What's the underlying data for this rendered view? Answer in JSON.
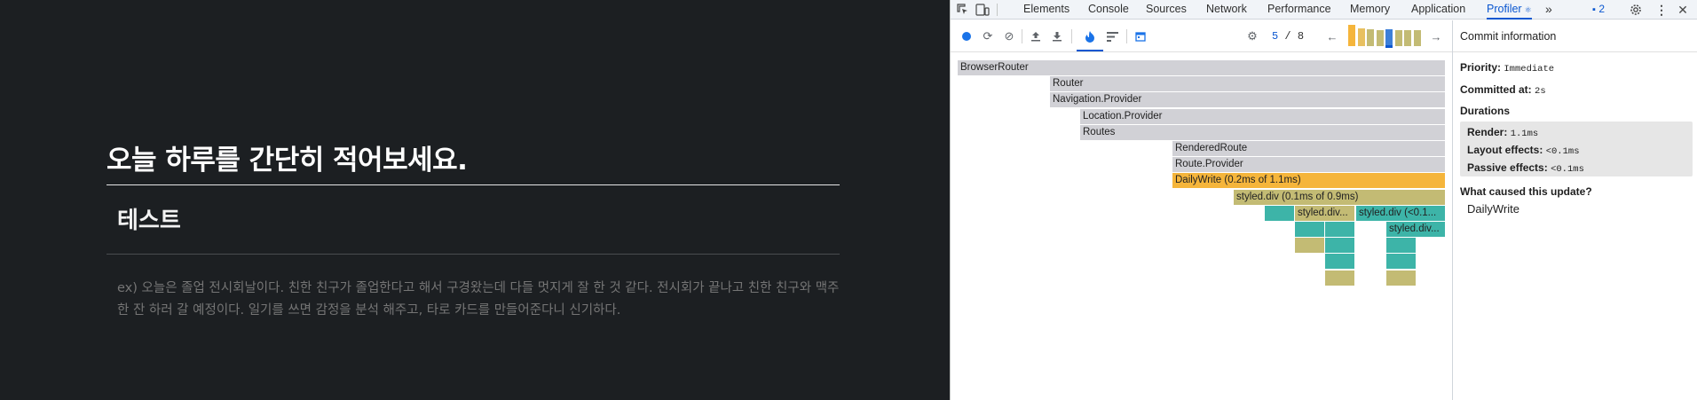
{
  "app": {
    "heading": "오늘 하루를 간단히 적어보세요.",
    "title_value": "테스트",
    "body_placeholder": "ex) 오늘은 졸업 전시회날이다. 친한 친구가 졸업한다고 해서 구경왔는데 다들 멋지게 잘 한 것 같다. 전시회가 끝나고 친한 친구와 맥주 한 잔 하러 갈 예정이다. 일기를 쓰면 감정을 분석 해주고, 타로 카드를 만들어준다니 신기하다."
  },
  "devtools": {
    "tabs": [
      {
        "label": "Elements"
      },
      {
        "label": "Console"
      },
      {
        "label": "Sources"
      },
      {
        "label": "Network"
      },
      {
        "label": "Performance"
      },
      {
        "label": "Memory"
      },
      {
        "label": "Application"
      },
      {
        "label": "Profiler",
        "active": true
      }
    ],
    "more_tabs_icon": "double-chevron-right-icon",
    "issues_count": "2",
    "accent_color": "#0b57d0"
  },
  "profiler": {
    "commit_current": "5",
    "commit_separator": "/",
    "commit_total": "8",
    "commits": [
      {
        "value": 1.0,
        "color": "#f5b53b"
      },
      {
        "value": 0.85,
        "color": "#e8c060"
      },
      {
        "value": 0.8,
        "color": "#c3bb74"
      },
      {
        "value": 0.75,
        "color": "#c3bb74"
      },
      {
        "value": 0.8,
        "color": "#3c7fd8",
        "selected": true
      },
      {
        "value": 0.75,
        "color": "#c3bb74"
      },
      {
        "value": 0.75,
        "color": "#c3bb74"
      },
      {
        "value": 0.75,
        "color": "#c3bb74"
      }
    ],
    "flamegraph": [
      {
        "label": "BrowserRouter",
        "color": "#d1d1d6"
      },
      {
        "label": "Router",
        "color": "#d1d1d6"
      },
      {
        "label": "Navigation.Provider",
        "color": "#d1d1d6"
      },
      {
        "label": "Location.Provider",
        "color": "#d1d1d6"
      },
      {
        "label": "Routes",
        "color": "#d1d1d6"
      },
      {
        "label": "RenderedRoute",
        "color": "#d1d1d6"
      },
      {
        "label": "Route.Provider",
        "color": "#d1d1d6"
      },
      {
        "label": "DailyWrite (0.2ms of 1.1ms)",
        "color": "#f5b53b"
      },
      {
        "label": "styled.div (0.1ms of 0.9ms)",
        "color": "#c3bb74"
      },
      {
        "label": "",
        "color": "#3db4a8"
      },
      {
        "label": "styled.div...",
        "color": "#c3bb74"
      },
      {
        "label": "styled.div (<0.1...",
        "color": "#3db4a8"
      },
      {
        "label": "",
        "color": "#3db4a8"
      },
      {
        "label": "",
        "color": "#3db4a8"
      },
      {
        "label": "styled.div...",
        "color": "#3db4a8"
      },
      {
        "label": "",
        "color": "#c3bb74"
      },
      {
        "label": "",
        "color": "#3db4a8"
      },
      {
        "label": "",
        "color": "#3db4a8"
      },
      {
        "label": "",
        "color": "#3db4a8"
      },
      {
        "label": "",
        "color": "#3db4a8"
      },
      {
        "label": "",
        "color": "#c3bb74"
      },
      {
        "label": "",
        "color": "#c3bb74"
      }
    ],
    "sidebar": {
      "header": "Commit information",
      "priority_label": "Priority:",
      "priority_value": "Immediate",
      "committed_label": "Committed at:",
      "committed_value": "2s",
      "durations_label": "Durations",
      "render_label": "Render:",
      "render_value": "1.1ms",
      "layout_label": "Layout effects:",
      "layout_value": "<0.1ms",
      "passive_label": "Passive effects:",
      "passive_value": "<0.1ms",
      "cause_label": "What caused this update?",
      "cause_component": "DailyWrite"
    }
  }
}
